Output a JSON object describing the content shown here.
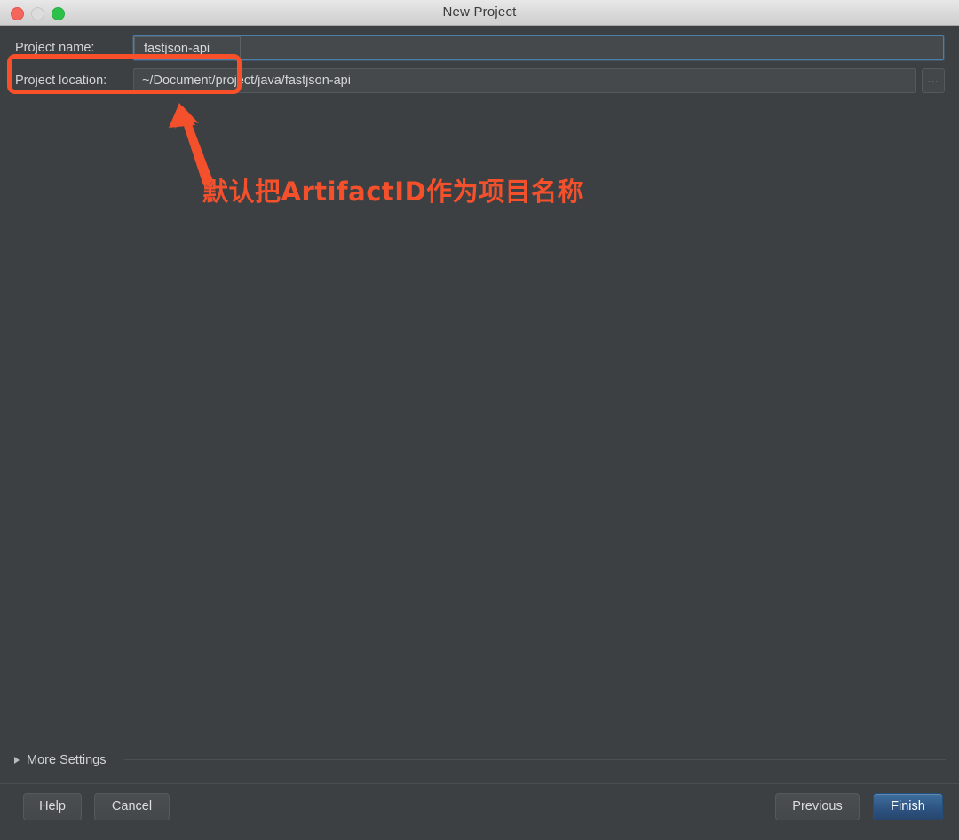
{
  "window": {
    "title": "New Project",
    "traffic_lights": [
      {
        "name": "close",
        "color": "#f4655b"
      },
      {
        "name": "minimize",
        "color": "#dcdcdc"
      },
      {
        "name": "zoom",
        "color": "#2ec14a"
      }
    ]
  },
  "form": {
    "project_name": {
      "label": "Project name:",
      "value": "fastjson-api",
      "placeholder": ""
    },
    "project_location": {
      "label": "Project location:",
      "value": "~/Document/project/java/fastjson-api",
      "placeholder": "",
      "browse_label": "..."
    }
  },
  "more_settings": {
    "label": "More Settings",
    "expanded": false,
    "disclosure_icon": "triangle-right-icon"
  },
  "footer": {
    "help_label": "Help",
    "cancel_label": "Cancel",
    "previous_label": "Previous",
    "finish_label": "Finish"
  },
  "annotation": {
    "text": "默认把ArtifactID作为项目名称",
    "color": "#f4502c",
    "highlight_shape": "rounded-rectangle",
    "arrow": "arrow-up-left"
  }
}
